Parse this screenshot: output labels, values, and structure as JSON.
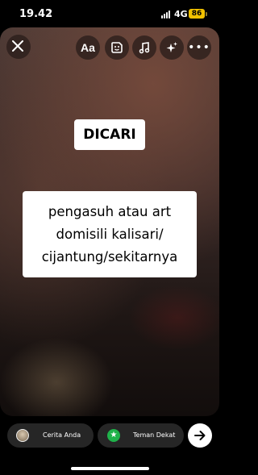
{
  "status": {
    "time": "19.42",
    "network": "4G",
    "battery": "86"
  },
  "toolbar": {
    "close_icon": "close-icon",
    "text_label": "Aa",
    "sticker_icon": "sticker-icon",
    "music_icon": "music-icon",
    "effects_icon": "sparkle-icon",
    "more_label": "•••"
  },
  "story": {
    "title": "DICARI",
    "lines": [
      "pengasuh atau art",
      "domisili kalisari/",
      "cijantung/sekitarnya"
    ]
  },
  "share": {
    "your_story": "Cerita Anda",
    "close_friends": "Teman Dekat",
    "next_icon": "arrow-right-icon"
  },
  "colors": {
    "battery": "#f2c200",
    "close_friends": "#1fb24a"
  }
}
